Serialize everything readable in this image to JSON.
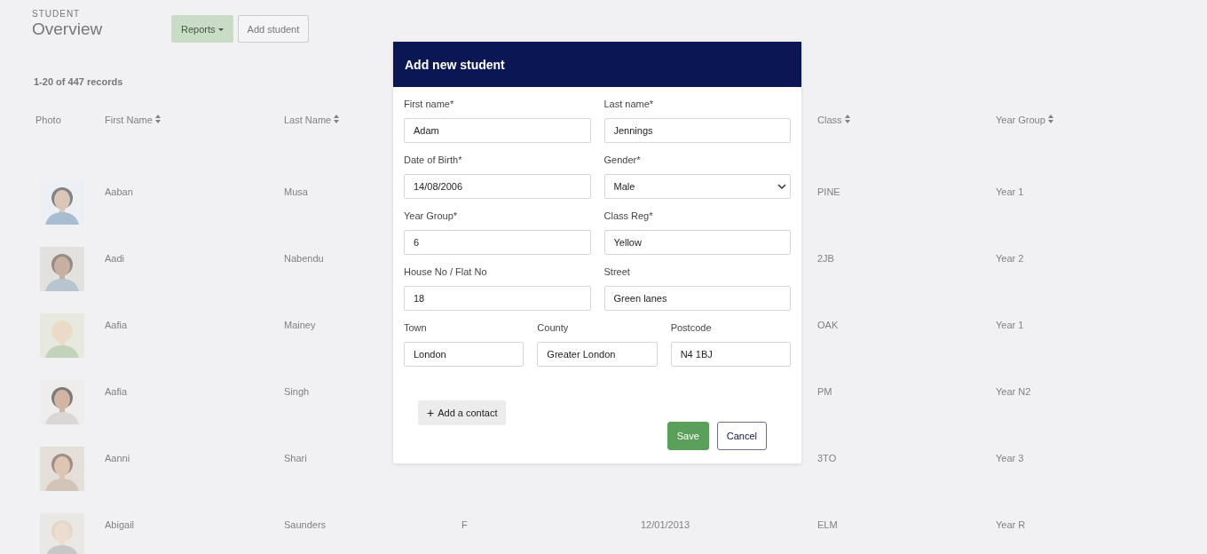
{
  "page": {
    "section_label": "STUDENT",
    "title": "Overview",
    "buttons": [
      {
        "label": "Reports",
        "kind": "dropdown"
      },
      {
        "label": "Add student",
        "kind": "outline"
      }
    ],
    "records": "1-20 of 447 records"
  },
  "table": {
    "columns": [
      {
        "label": "Photo",
        "sortable": false
      },
      {
        "label": "First Name",
        "sortable": true
      },
      {
        "label": "Last Name",
        "sortable": true
      },
      {
        "label": "Class",
        "sortable": true
      },
      {
        "label": "Year Group",
        "sortable": true
      }
    ],
    "rows": [
      {
        "first_name": "Aaban",
        "last_name": "Musa",
        "class": "PINE",
        "year_group": "Year 1"
      },
      {
        "first_name": "Aadi",
        "last_name": "Nabendu",
        "class": "2JB",
        "year_group": "Year 2"
      },
      {
        "first_name": "Aafia",
        "last_name": "Mainey",
        "class": "OAK",
        "year_group": "Year 1"
      },
      {
        "first_name": "Aafia",
        "last_name": "Singh",
        "class": "PM",
        "year_group": "Year N2"
      },
      {
        "first_name": "Aanni",
        "last_name": "Shari",
        "class": "3TO",
        "year_group": "Year 3"
      },
      {
        "first_name": "Abigail",
        "last_name": "Saunders",
        "gender": "F",
        "date_of_birth": "12/01/2013",
        "class": "ELM",
        "year_group": "Year R"
      }
    ]
  },
  "modal": {
    "title": "Add new student",
    "form_rows": [
      [
        {
          "label": "First name*",
          "value": "Adam",
          "kind": "text"
        },
        {
          "label": "Last name*",
          "value": "Jennings",
          "kind": "text"
        }
      ],
      [
        {
          "label": "Date of Birth*",
          "value": "14/08/2006",
          "kind": "text"
        },
        {
          "label": "Gender*",
          "value": "Male",
          "kind": "select"
        }
      ],
      [
        {
          "label": "Year Group*",
          "value": "6",
          "kind": "text"
        },
        {
          "label": "Class Reg*",
          "value": "Yellow",
          "kind": "text"
        }
      ],
      [
        {
          "label": "House No / Flat No",
          "value": "18",
          "kind": "text"
        },
        {
          "label": "Street",
          "value": "Green lanes",
          "kind": "text"
        }
      ],
      [
        {
          "label": "Town",
          "value": "London",
          "kind": "text"
        },
        {
          "label": "County",
          "value": "Greater London",
          "kind": "text"
        },
        {
          "label": "Postcode",
          "value": "N4 1BJ",
          "kind": "text"
        }
      ]
    ],
    "add_contact": {
      "icon": "+",
      "label": "Add a contact"
    },
    "buttons": [
      {
        "label": "Save",
        "kind": "primary"
      },
      {
        "label": "Cancel",
        "kind": "secondary"
      }
    ]
  }
}
